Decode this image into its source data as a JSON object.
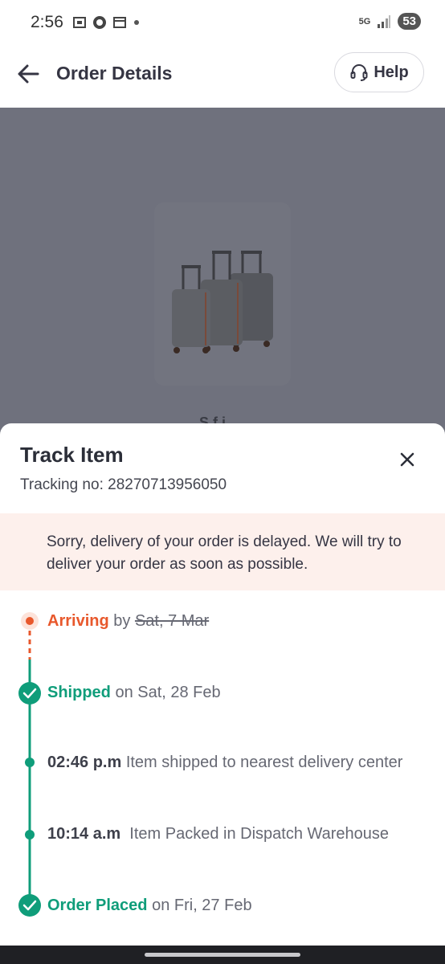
{
  "status_bar": {
    "time": "2:56",
    "network": "5G",
    "battery": "53"
  },
  "header": {
    "title": "Order Details",
    "help_label": "Help"
  },
  "product": {
    "name_peek": "S f i"
  },
  "track_sheet": {
    "title": "Track Item",
    "tracking_label": "Tracking no: ",
    "tracking_number": "28270713956050",
    "delay_message": "Sorry, delivery of your order is delayed. We will try to deliver your order as soon as possible."
  },
  "timeline": {
    "arriving": {
      "status": "Arriving",
      "connector": " by ",
      "date": "Sat, 7 Mar"
    },
    "shipped": {
      "status": "Shipped",
      "connector": " on ",
      "date": "Sat, 28 Feb"
    },
    "event1": {
      "time": "02:46 p.m",
      "text": " Item shipped to nearest delivery center"
    },
    "event2": {
      "time": "10:14 a.m",
      "text": "  Item Packed in Dispatch Warehouse"
    },
    "placed": {
      "status": "Order Placed",
      "connector": " on ",
      "date": "Fri, 27 Feb"
    }
  },
  "colors": {
    "accent_orange": "#e8582c",
    "accent_green": "#0f9d7a",
    "banner_bg": "#fdf0ec",
    "overlay": "#6f717d"
  }
}
